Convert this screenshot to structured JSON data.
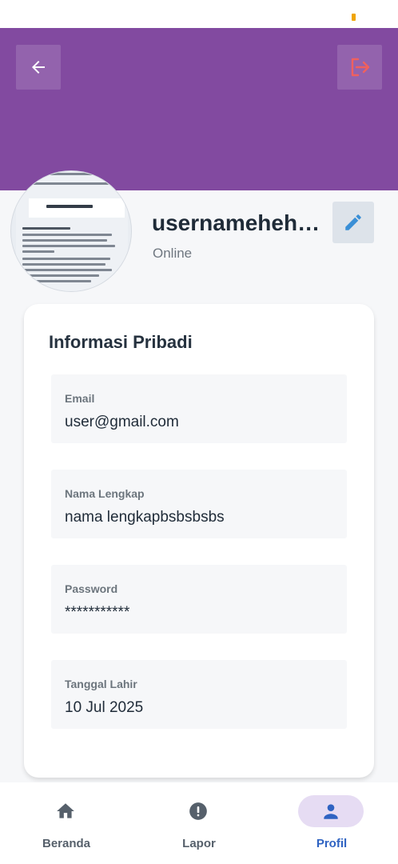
{
  "header": {
    "background_color": "#824aa0",
    "back_icon": "arrow-left-icon",
    "logout_icon": "logout-icon",
    "logout_icon_color": "#f0605e"
  },
  "profile": {
    "username": "usernameheheheh",
    "status": "Online",
    "edit_icon": "pencil-icon",
    "edit_icon_color": "#3a8fd6"
  },
  "info": {
    "title": "Informasi Pribadi",
    "fields": [
      {
        "label": "Email",
        "value": "user@gmail.com"
      },
      {
        "label": "Nama Lengkap",
        "value": "nama lengkapbsbsbsbs"
      },
      {
        "label": "Password",
        "value": "***********"
      },
      {
        "label": "Tanggal Lahir",
        "value": "10 Jul 2025"
      }
    ]
  },
  "nav": {
    "items": [
      {
        "label": "Beranda",
        "icon": "home-icon",
        "active": false
      },
      {
        "label": "Lapor",
        "icon": "alert-icon",
        "active": false
      },
      {
        "label": "Profil",
        "icon": "person-icon",
        "active": true
      }
    ],
    "active_color": "#2f63c2"
  }
}
